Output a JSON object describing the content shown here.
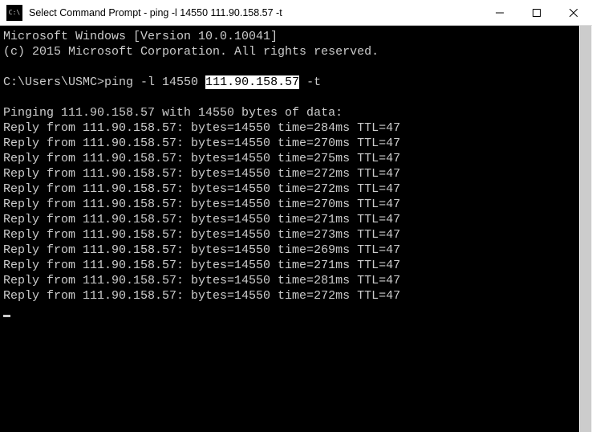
{
  "titlebar": {
    "icon_glyph": "C:\\",
    "title": "Select Command Prompt - ping  -l 14550 111.90.158.57 -t"
  },
  "terminal": {
    "banner1": "Microsoft Windows [Version 10.0.10041]",
    "banner2": "(c) 2015 Microsoft Corporation. All rights reserved.",
    "prompt_prefix": "C:\\Users\\USMC>",
    "cmd_before": "ping -l 14550 ",
    "cmd_highlight": "111.90.158.57",
    "cmd_after": " -t",
    "ping_header": "Pinging 111.90.158.57 with 14550 bytes of data:",
    "ip": "111.90.158.57",
    "bytes": 14550,
    "ttl": 47,
    "replies": [
      {
        "time": 284
      },
      {
        "time": 270
      },
      {
        "time": 275
      },
      {
        "time": 272
      },
      {
        "time": 272
      },
      {
        "time": 270
      },
      {
        "time": 271
      },
      {
        "time": 273
      },
      {
        "time": 269
      },
      {
        "time": 271
      },
      {
        "time": 281
      },
      {
        "time": 272
      }
    ]
  }
}
